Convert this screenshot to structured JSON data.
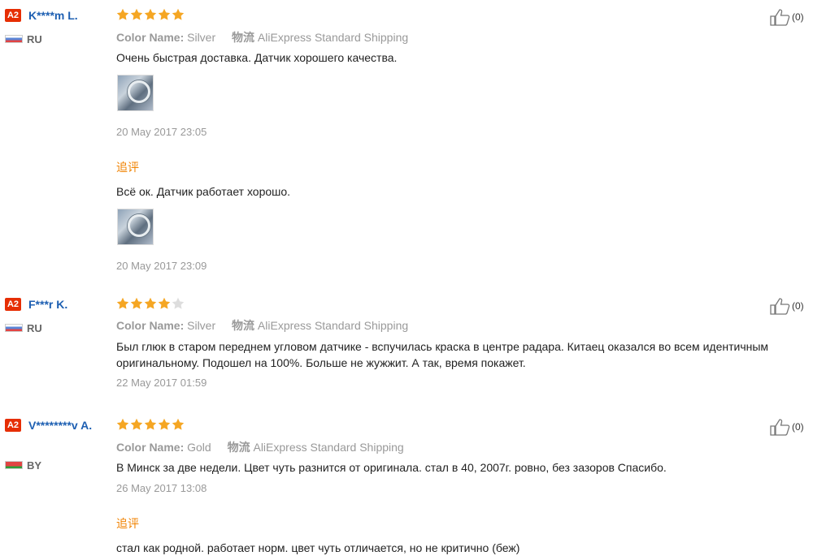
{
  "reviews": [
    {
      "level": "A2",
      "name": "K****m L.",
      "country": "RU",
      "stars": 5,
      "color_key": "Color Name:",
      "color_value": "Silver",
      "ship_key": "物流",
      "ship_value": "AliExpress Standard Shipping",
      "text": "Очень быстрая доставка. Датчик хорошего качества.",
      "date": "20 May 2017 23:05",
      "followup_label": "追评",
      "followup_text": "Всё ок. Датчик работает хорошо.",
      "followup_date": "20 May 2017 23:09",
      "likes": "(0)"
    },
    {
      "level": "A2",
      "name": "F***r K.",
      "country": "RU",
      "stars": 4,
      "color_key": "Color Name:",
      "color_value": "Silver",
      "ship_key": "物流",
      "ship_value": "AliExpress Standard Shipping",
      "text": "Был глюк в старом переднем угловом датчике - вспучилась краска в центре радара. Китаец оказался во всем идентичным оригинальному. Подошел на 100%. Больше не жужжит. А так, время покажет.",
      "date": "22 May 2017 01:59",
      "likes": "(0)"
    },
    {
      "level": "A2",
      "name": "V********v A.",
      "country": "BY",
      "stars": 5,
      "color_key": "Color Name:",
      "color_value": "Gold",
      "ship_key": "物流",
      "ship_value": "AliExpress Standard Shipping",
      "text": "В Минск за две недели. Цвет чуть разнится от оригинала. стал в 40, 2007г. ровно, без зазоров Спасибо.",
      "date": "26 May 2017 13:08",
      "followup_label": "追评",
      "followup_text": "стал как родной. работает норм. цвет чуть отличается, но не критично (беж)",
      "likes": "(0)"
    }
  ],
  "colors": {
    "star_on": "#f5a623",
    "star_off": "#dddddd",
    "followup": "#f08200",
    "username": "#1d5fb2"
  }
}
